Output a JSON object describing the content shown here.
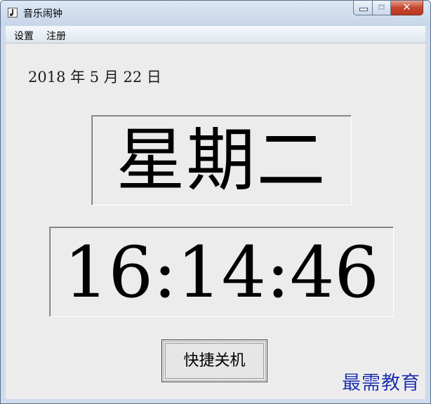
{
  "window": {
    "title": "音乐闹钟",
    "icon": "music-clock-icon"
  },
  "titlebar_buttons": {
    "minimize_icon": "minimize-icon",
    "maximize_icon": "maximize-icon",
    "close_icon": "close-icon",
    "close_glyph": "✕"
  },
  "menu": {
    "items": [
      {
        "label": "设置"
      },
      {
        "label": "注册"
      }
    ]
  },
  "clock": {
    "date": "2018 年 5 月 22 日",
    "weekday": "星期二",
    "time": "16:14:46"
  },
  "actions": {
    "shutdown_label": "快捷关机"
  },
  "watermark": {
    "text": "最需教育"
  },
  "colors": {
    "close_button": "#c6452c",
    "watermark": "#1e2fa8",
    "frame": "#cfdaea"
  }
}
